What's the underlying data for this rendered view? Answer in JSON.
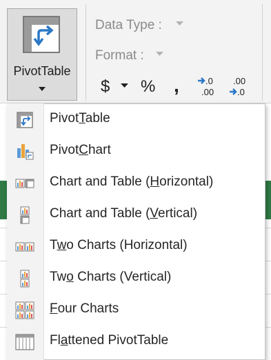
{
  "ribbon": {
    "pivot_button_label": "PivotTable",
    "data_type_label": "Data Type :",
    "format_label": "Format :",
    "currency_symbol": "$",
    "percent_symbol": "%",
    "comma_symbol": ",",
    "increase_decimal": {
      "top": ".0",
      "bottom": ".00"
    },
    "decrease_decimal": {
      "top": ".00",
      "bottom": ".0"
    }
  },
  "menu": {
    "items": [
      {
        "pre": "Pivot",
        "ul": "T",
        "post": "able",
        "icon": "pivottable-icon"
      },
      {
        "pre": "Pivot",
        "ul": "C",
        "post": "hart",
        "icon": "pivotchart-icon"
      },
      {
        "pre": "Chart and Table (",
        "ul": "H",
        "post": "orizontal)",
        "icon": "chart-table-horizontal-icon"
      },
      {
        "pre": "Chart and Table (",
        "ul": "V",
        "post": "ertical)",
        "icon": "chart-table-vertical-icon"
      },
      {
        "pre": "T",
        "ul": "w",
        "post": "o Charts (Horizontal)",
        "icon": "two-charts-horizontal-icon"
      },
      {
        "pre": "Tw",
        "ul": "o",
        "post": " Charts (Vertical)",
        "icon": "two-charts-vertical-icon"
      },
      {
        "pre": "",
        "ul": "F",
        "post": "our Charts",
        "icon": "four-charts-icon"
      },
      {
        "pre": "Fl",
        "ul": "a",
        "post": "ttened PivotTable",
        "icon": "flattened-pivottable-icon"
      }
    ]
  },
  "colors": {
    "accent_green": "#2f7a45",
    "icon_blue": "#2b78c5",
    "chart_orange": "#e8a33c"
  }
}
